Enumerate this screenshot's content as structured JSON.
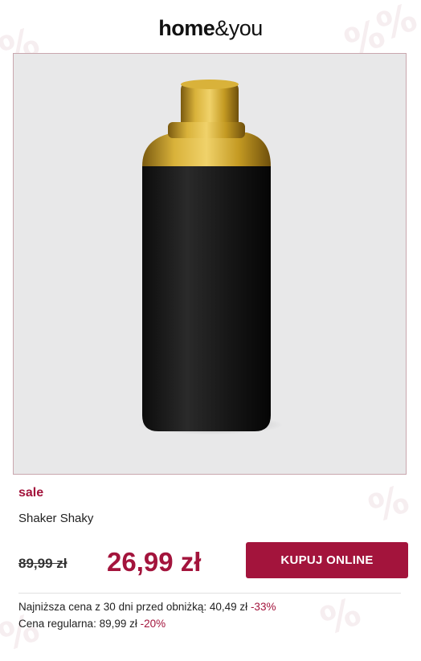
{
  "brand": {
    "logo_bold": "home",
    "logo_amp": "&",
    "logo_light": "you"
  },
  "product": {
    "image_alt": "Shaker Shaky",
    "badge": "sale",
    "name": "Shaker Shaky",
    "old_price": "89,99 zł",
    "new_price": "26,99 zł",
    "buy_label": "KUPUJ ONLINE"
  },
  "info": {
    "lowest_label": "Najniższa cena z 30 dni przed obniżką: 40,49 zł",
    "lowest_pct": "-33%",
    "regular_label": "Cena regularna: 89,99 zł",
    "regular_pct": "-20%"
  },
  "colors": {
    "accent": "#a3143c",
    "image_bg": "#e8e8e9",
    "gold": "#c9a227",
    "black": "#141414"
  },
  "icons": {
    "background_pattern": "percent-sign-icon"
  }
}
